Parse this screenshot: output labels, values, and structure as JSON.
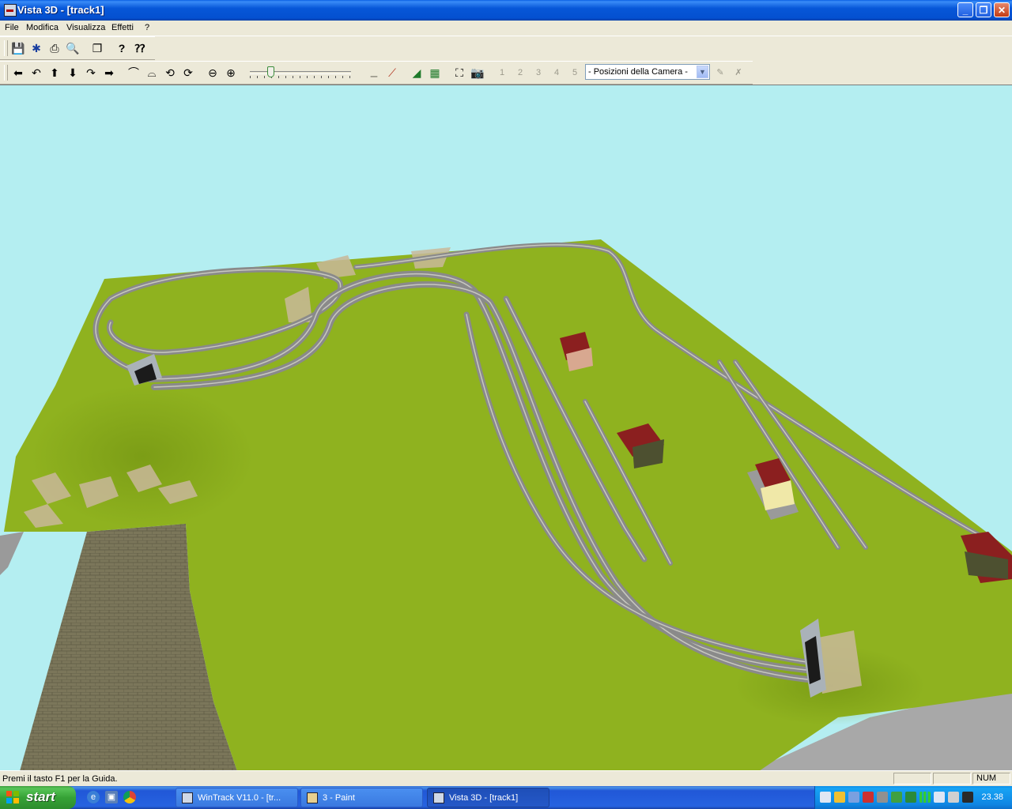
{
  "window": {
    "title": "Vista 3D - [track1]",
    "controls": {
      "minimize": "_",
      "restore": "❐",
      "close": "✕"
    }
  },
  "menu": [
    "File",
    "Modifica",
    "Visualizza",
    "Effetti",
    "?"
  ],
  "toolbar1": {
    "icons": [
      "save-icon",
      "cameras-icon",
      "print-icon",
      "print-preview-icon",
      "copy-icon",
      "help-icon",
      "context-help-icon"
    ]
  },
  "toolbar2": {
    "nav_icons": [
      "arrow-left-icon",
      "turn-left-icon",
      "arrow-up-icon",
      "arrow-down-icon",
      "turn-right-icon",
      "arrow-right-icon"
    ],
    "view_icons": [
      "view-tilt-up-icon",
      "view-tilt-down-icon",
      "view-rotate-left-icon",
      "view-rotate-right-icon"
    ],
    "zoom_icons": [
      "zoom-out-icon",
      "zoom-in-icon"
    ],
    "slider_level": 0.18,
    "camera_slots": [
      "1",
      "2",
      "3",
      "4",
      "5"
    ],
    "camera_select": {
      "value": "- Posizioni della Camera -"
    }
  },
  "status": {
    "help_text": "Premi il tasto F1 per la Guida.",
    "num": "NUM"
  },
  "taskbar": {
    "start_label": "start",
    "tasks": [
      {
        "label": "WinTrack  V11.0 - [tr...",
        "active": false
      },
      {
        "label": "3 - Paint",
        "active": false
      },
      {
        "label": "Vista 3D - [track1]",
        "active": true
      }
    ],
    "clock": "23.38"
  },
  "colors": {
    "grass": "#8fb21f",
    "sky": "#b4eef1",
    "track": "#8a8a8a",
    "roof": "#8b1f1f",
    "brick": "#7b765a"
  }
}
